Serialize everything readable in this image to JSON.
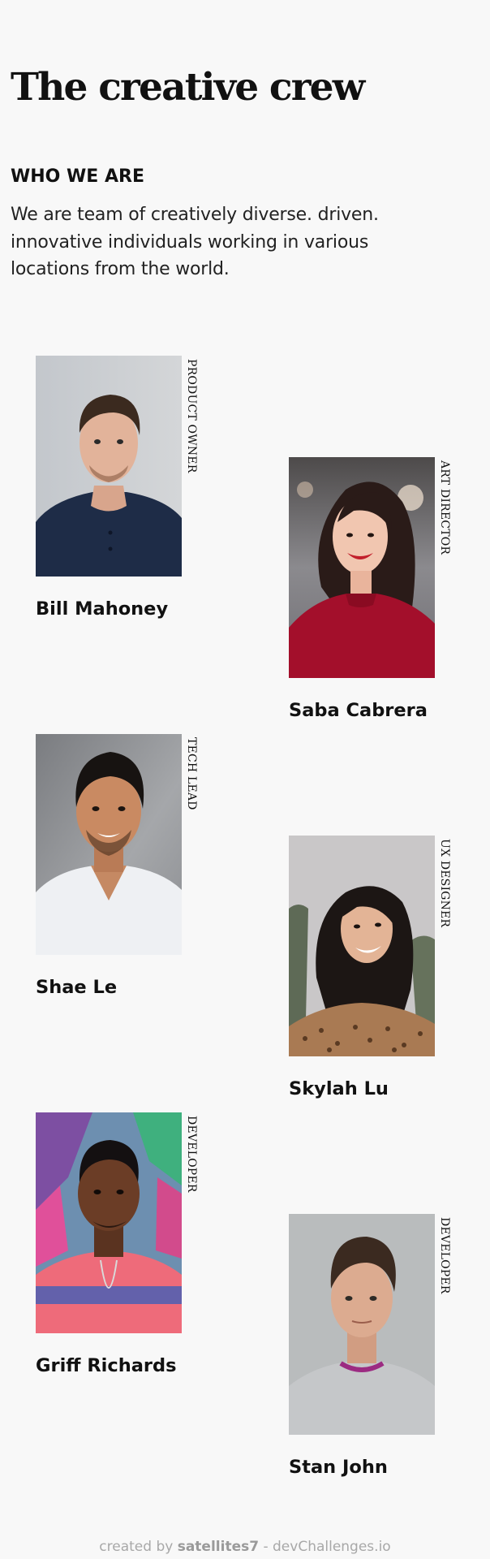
{
  "header": {
    "title": "The creative crew"
  },
  "about": {
    "heading": "WHO WE ARE",
    "text": "We are team of creatively diverse. driven. innovative individuals working in various locations from the world."
  },
  "team": [
    {
      "name": "Bill Mahoney",
      "role": "PRODUCT OWNER",
      "photo_icon": "portrait-photo"
    },
    {
      "name": "Saba Cabrera",
      "role": "ART DIRECTOR",
      "photo_icon": "portrait-photo"
    },
    {
      "name": "Shae Le",
      "role": "TECH LEAD",
      "photo_icon": "portrait-photo"
    },
    {
      "name": "Skylah Lu",
      "role": "UX DESIGNER",
      "photo_icon": "portrait-photo"
    },
    {
      "name": "Griff Richards",
      "role": "DEVELOPER",
      "photo_icon": "portrait-photo"
    },
    {
      "name": "Stan John",
      "role": "DEVELOPER",
      "photo_icon": "portrait-photo"
    }
  ],
  "footer": {
    "prefix": "created by",
    "author": "satellites7",
    "suffix": "- devChallenges.io"
  },
  "colors": {
    "background": "#f8f8f8",
    "text": "#111111",
    "footer_text": "#a8a8a8"
  }
}
